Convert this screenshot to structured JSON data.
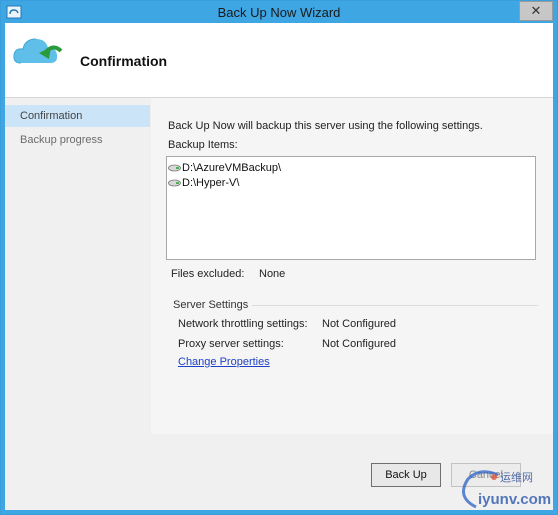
{
  "window": {
    "title": "Back Up Now Wizard",
    "close_glyph": "✕"
  },
  "header": {
    "heading": "Confirmation",
    "icon": "cloud-backup-icon"
  },
  "nav": {
    "items": [
      {
        "label": "Confirmation",
        "active": true
      },
      {
        "label": "Backup progress",
        "active": false
      }
    ]
  },
  "content": {
    "intro": "Back Up Now will backup this server using the following settings.",
    "backup_items_label": "Backup Items:",
    "backup_items": [
      "D:\\AzureVMBackup\\",
      "D:\\Hyper-V\\"
    ],
    "files_excluded_label": "Files excluded:",
    "files_excluded_value": "None",
    "server_settings": {
      "title": "Server Settings",
      "rows": [
        {
          "label": "Network throttling settings:",
          "value": "Not Configured"
        },
        {
          "label": "Proxy server settings:",
          "value": "Not Configured"
        }
      ],
      "link": "Change Properties"
    }
  },
  "buttons": {
    "back": "Back Up",
    "cancel": "Cancel"
  },
  "watermark": {
    "top": "运维网",
    "bottom": "iyunv.com"
  },
  "colors": {
    "titlebar": "#3fa6e4",
    "nav_active": "#cce4f7",
    "link": "#1f3fc6"
  }
}
